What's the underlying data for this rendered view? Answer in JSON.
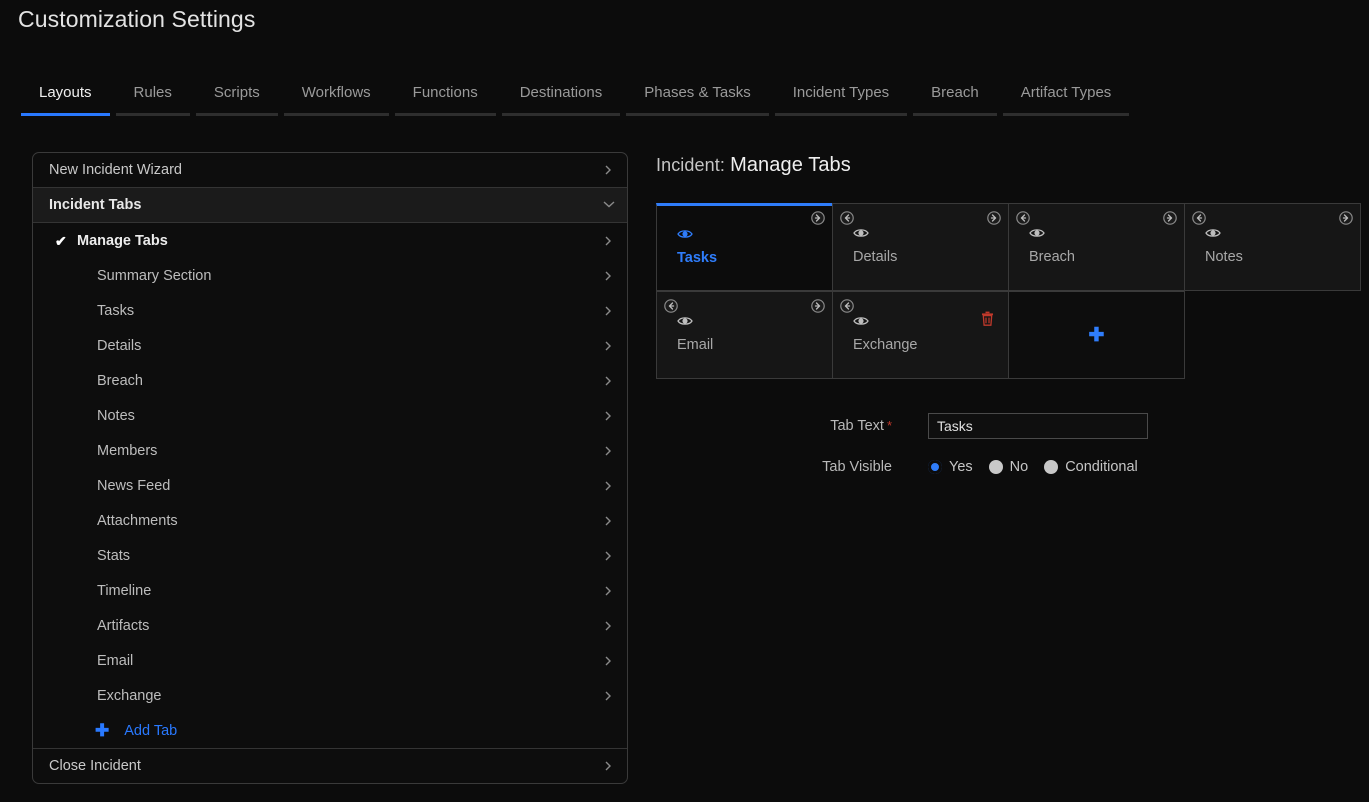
{
  "page": {
    "title": "Customization Settings"
  },
  "nav": {
    "tabs": [
      {
        "label": "Layouts",
        "active": true
      },
      {
        "label": "Rules",
        "active": false
      },
      {
        "label": "Scripts",
        "active": false
      },
      {
        "label": "Workflows",
        "active": false
      },
      {
        "label": "Functions",
        "active": false
      },
      {
        "label": "Destinations",
        "active": false
      },
      {
        "label": "Phases & Tasks",
        "active": false
      },
      {
        "label": "Incident Types",
        "active": false
      },
      {
        "label": "Breach",
        "active": false
      },
      {
        "label": "Artifact Types",
        "active": false
      }
    ]
  },
  "sidebar": {
    "new_incident_wizard": "New Incident Wizard",
    "incident_tabs_header": "Incident Tabs",
    "manage_tabs": "Manage Tabs",
    "children": [
      "Summary Section",
      "Tasks",
      "Details",
      "Breach",
      "Notes",
      "Members",
      "News Feed",
      "Attachments",
      "Stats",
      "Timeline",
      "Artifacts",
      "Email",
      "Exchange"
    ],
    "add_tab": "Add Tab",
    "close_incident": "Close Incident"
  },
  "panel": {
    "title_prefix": "Incident:",
    "title_main": "Manage Tabs",
    "cards_row1": [
      {
        "label": "Tasks",
        "selected": true,
        "has_left": false,
        "has_right": true,
        "has_delete": false
      },
      {
        "label": "Details",
        "selected": false,
        "has_left": true,
        "has_right": true,
        "has_delete": false
      },
      {
        "label": "Breach",
        "selected": false,
        "has_left": true,
        "has_right": true,
        "has_delete": false
      },
      {
        "label": "Notes",
        "selected": false,
        "has_left": true,
        "has_right": true,
        "has_delete": false
      }
    ],
    "cards_row2": [
      {
        "label": "Email",
        "selected": false,
        "has_left": true,
        "has_right": true,
        "has_delete": false
      },
      {
        "label": "Exchange",
        "selected": false,
        "has_left": true,
        "has_right": false,
        "has_delete": true
      }
    ],
    "add_card_glyph": "✚"
  },
  "form": {
    "tab_text_label": "Tab Text",
    "tab_text_required": "*",
    "tab_text_value": "Tasks",
    "tab_visible_label": "Tab Visible",
    "visible_options": [
      {
        "label": "Yes",
        "selected": true
      },
      {
        "label": "No",
        "selected": false
      },
      {
        "label": "Conditional",
        "selected": false
      }
    ]
  },
  "icons": {
    "eye": "eye-icon",
    "check": "✔",
    "plus": "✚",
    "chevron_right": "chevron-right-icon",
    "chevron_down": "chevron-down-icon",
    "trash": "trash-icon"
  },
  "colors": {
    "accent": "#2f7dfb",
    "danger": "#c0392b",
    "background": "#0c0c0c",
    "border": "#3a3a3a"
  }
}
